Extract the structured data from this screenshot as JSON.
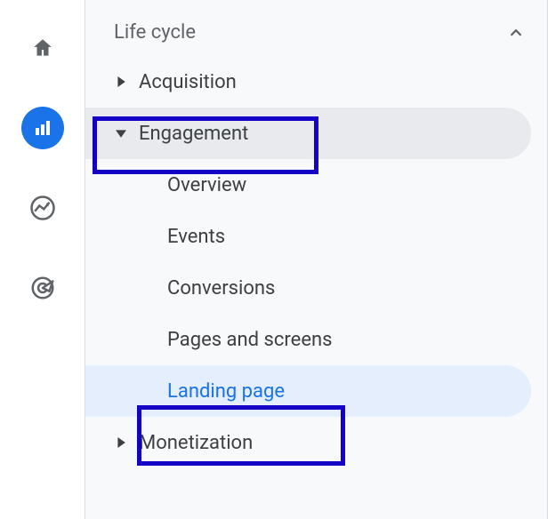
{
  "rail": {
    "items": [
      {
        "name": "home-icon"
      },
      {
        "name": "reports-icon"
      },
      {
        "name": "explore-icon"
      },
      {
        "name": "advertising-icon"
      }
    ]
  },
  "section": {
    "title": "Life cycle"
  },
  "tree": {
    "acquisition": "Acquisition",
    "engagement": "Engagement",
    "engagement_children": {
      "overview": "Overview",
      "events": "Events",
      "conversions": "Conversions",
      "pages": "Pages and screens",
      "landing": "Landing page"
    },
    "monetization": "Monetization"
  },
  "colors": {
    "accent": "#1a73e8",
    "highlight_border": "#1400c6",
    "text_muted": "#5f6368"
  }
}
